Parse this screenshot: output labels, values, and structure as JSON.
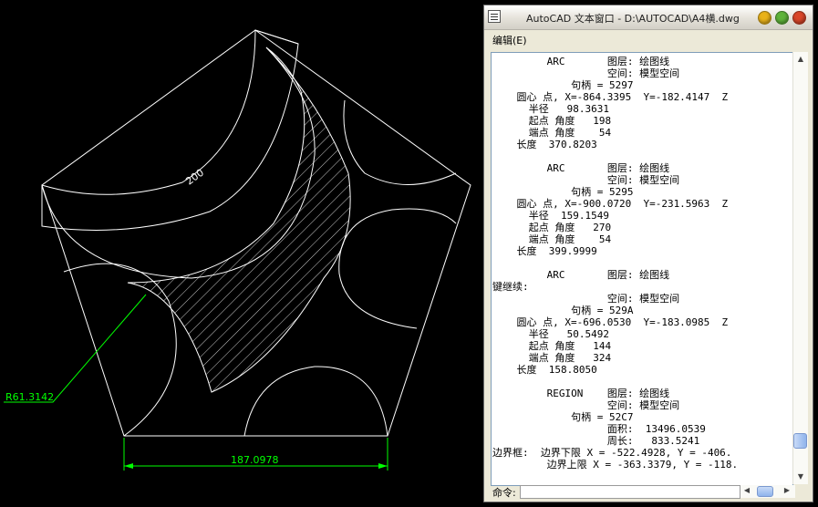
{
  "drawing": {
    "dim_width": "200",
    "dim_base": "187.0978",
    "dim_radius": "R61.3142"
  },
  "window": {
    "title": "AutoCAD 文本窗口 - D:\\AUTOCAD\\A4横.dwg",
    "menu_edit": "编辑(E)",
    "log_text": "         ARC       图层: 绘图线\n                   空间: 模型空间\n             句柄 = 5297\n    圆心 点, X=-864.3395  Y=-182.4147  Z\n      半径   98.3631\n      起点 角度   198\n      端点 角度    54\n    长度  370.8203\n\n         ARC       图层: 绘图线\n                   空间: 模型空间\n             句柄 = 5295\n    圆心 点, X=-900.0720  Y=-231.5963  Z\n      半径  159.1549\n      起点 角度   270\n      端点 角度    54\n    长度  399.9999\n\n         ARC       图层: 绘图线\n键继续:\n                   空间: 模型空间\n             句柄 = 529A\n    圆心 点, X=-696.0530  Y=-183.0985  Z\n      半径   50.5492\n      起点 角度   144\n      端点 角度   324\n    长度  158.8050\n\n         REGION    图层: 绘图线\n                   空间: 模型空间\n             句柄 = 52C7\n                   面积:  13496.0539\n                   周长:   833.5241\n边界框:  边界下限 X = -522.4928, Y = -406.\n         边界上限 X = -363.3379, Y = -118.",
    "command_label": "命令:",
    "colors": {
      "close": "#d9462a",
      "maximize": "#5fb33a",
      "minimize": "#e9b21a",
      "drawing_lines": "#ffffff",
      "dimension": "#00ff00"
    }
  }
}
